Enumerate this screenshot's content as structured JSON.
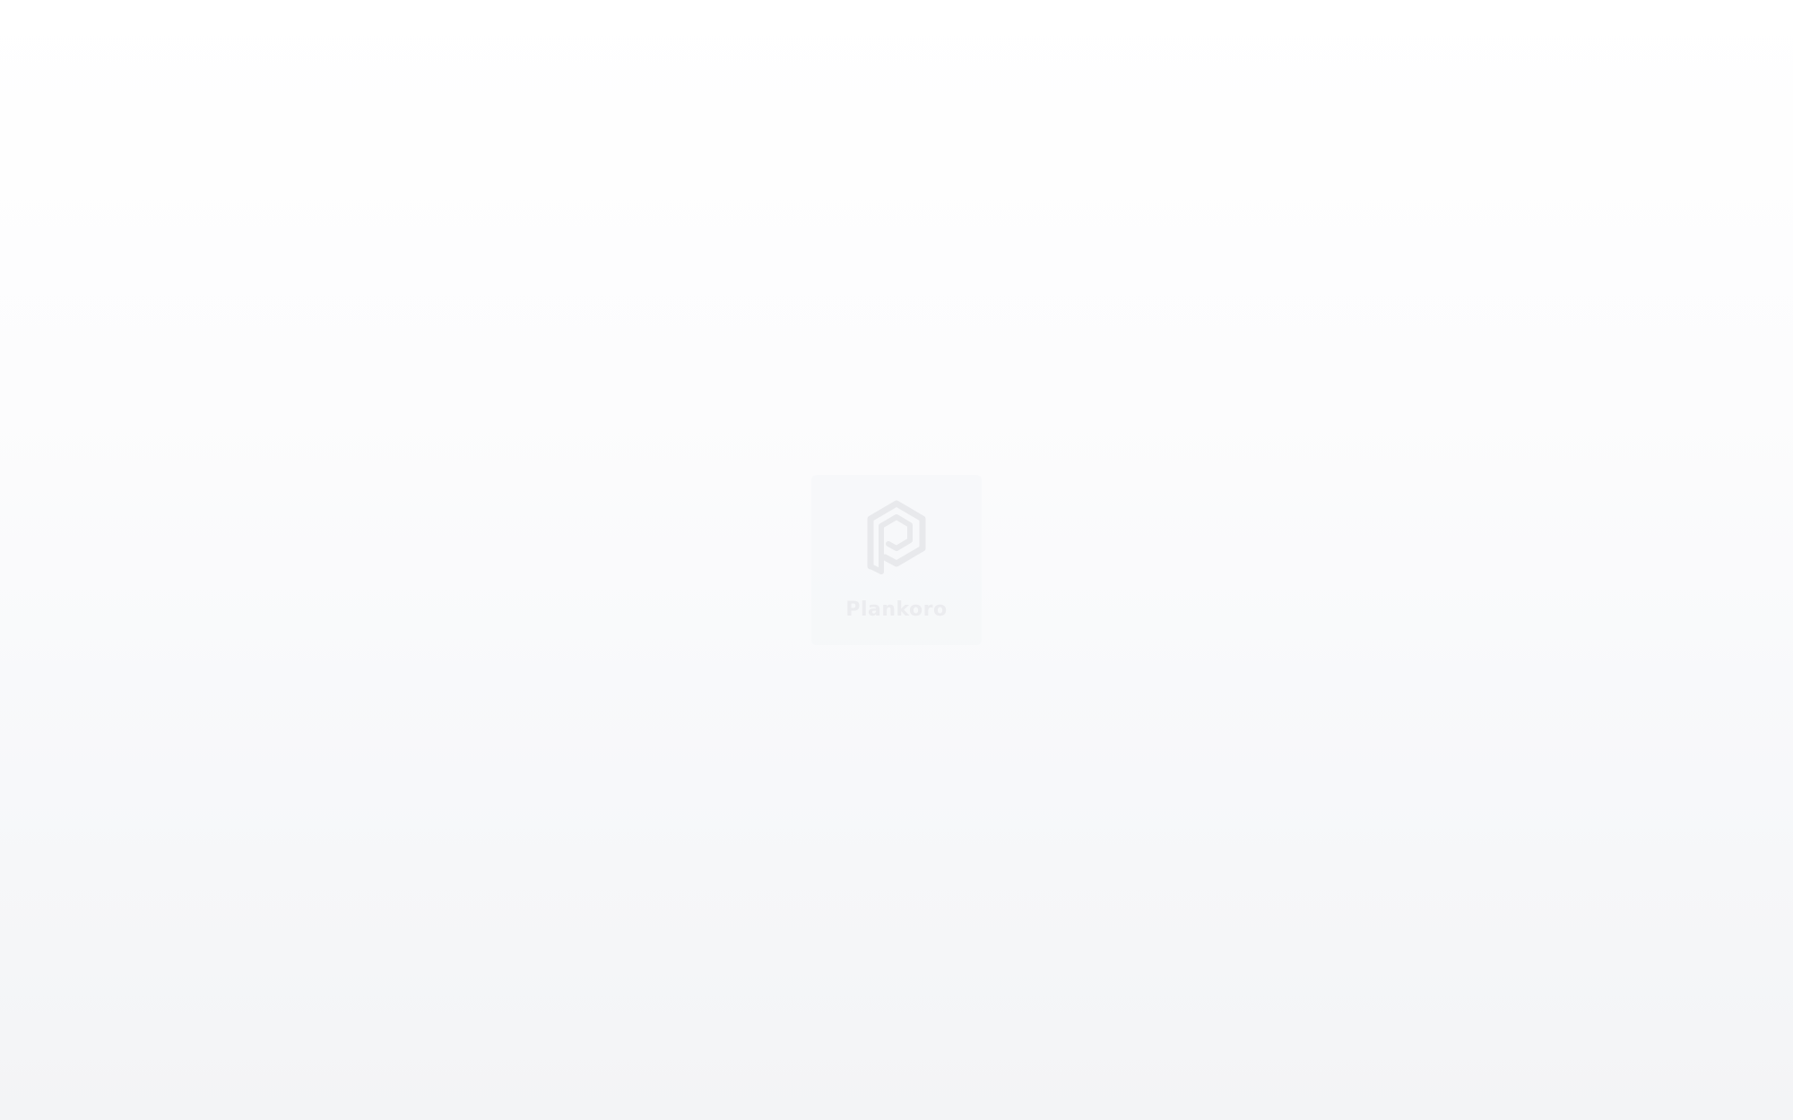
{
  "app": {
    "brand_name": "Plankoro",
    "logo_icon": "plankoro-hexagon-p-logo-icon"
  },
  "colors": {
    "background_top": "#ffffff",
    "background_bottom": "#f3f4f6",
    "logo_card": "#f4f5f7",
    "logo_mark": "#e7e8eb",
    "logo_text": "#ebecef"
  }
}
